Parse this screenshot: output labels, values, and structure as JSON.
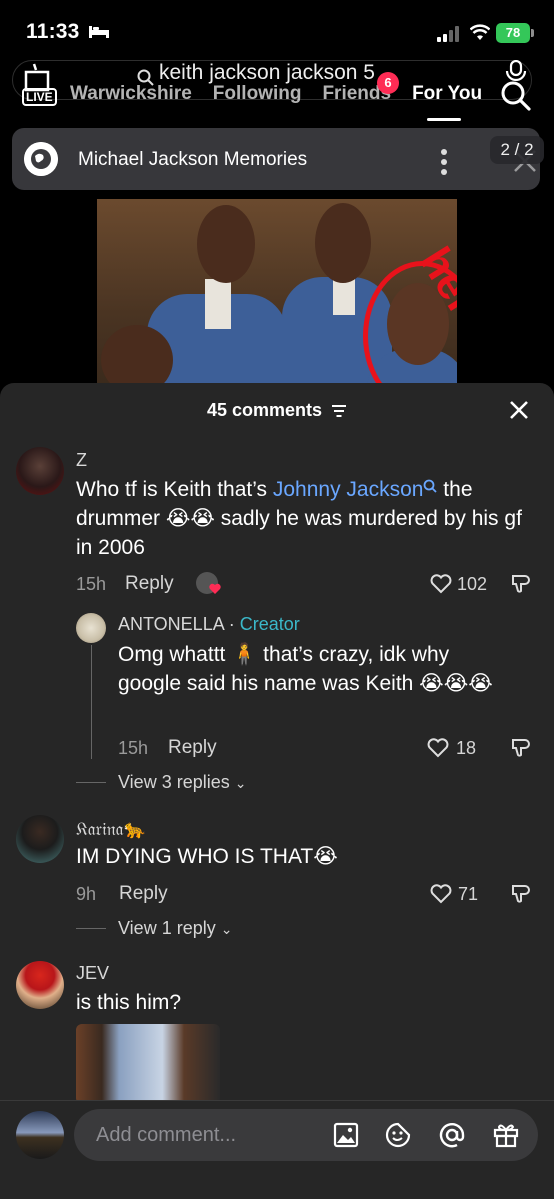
{
  "status_bar": {
    "time": "11:33",
    "battery": "78"
  },
  "nav": {
    "search_query": "keith jackson jackson 5",
    "tabs": [
      "Warwickshire",
      "Following",
      "Friends",
      "For You"
    ],
    "active_tab": "For You",
    "friends_badge": "6",
    "live_label": "LIVE"
  },
  "banner": {
    "title": "Michael Jackson Memories",
    "page": "2 / 2"
  },
  "video": {
    "overlay_text": "here"
  },
  "comments": {
    "count_label": "45 comments",
    "items": [
      {
        "user": "Z",
        "text_before": "Who tf is Keith that’s ",
        "mention": "Johnny Jackson",
        "text_after": " the drummer 😭😭 sadly he was murdered by his gf in 2006",
        "time": "15h",
        "reply": "Reply",
        "likes": "102"
      },
      {
        "user": "ANTONELLA",
        "user_tag": "Creator",
        "text": "Omg whattt 🧍 that’s crazy, idk why google said his name was Keith 😭😭😭",
        "time": "15h",
        "reply": "Reply",
        "likes": "18",
        "view_more": "View 3 replies"
      },
      {
        "user": "𝔎𝔞𝔯𝔦𝔫𝔞🐆",
        "text": "IM DYING WHO IS THAT😭",
        "time": "9h",
        "reply": "Reply",
        "likes": "71",
        "view_more": "View 1 reply"
      },
      {
        "user": "JEV",
        "text": "is this him?"
      }
    ]
  },
  "input": {
    "placeholder": "Add comment..."
  },
  "colors": {
    "accent_red": "#fe2c55",
    "mention_blue": "#6aa7ff",
    "creator_teal": "#3bb8c9",
    "sheet_bg": "#262626"
  }
}
